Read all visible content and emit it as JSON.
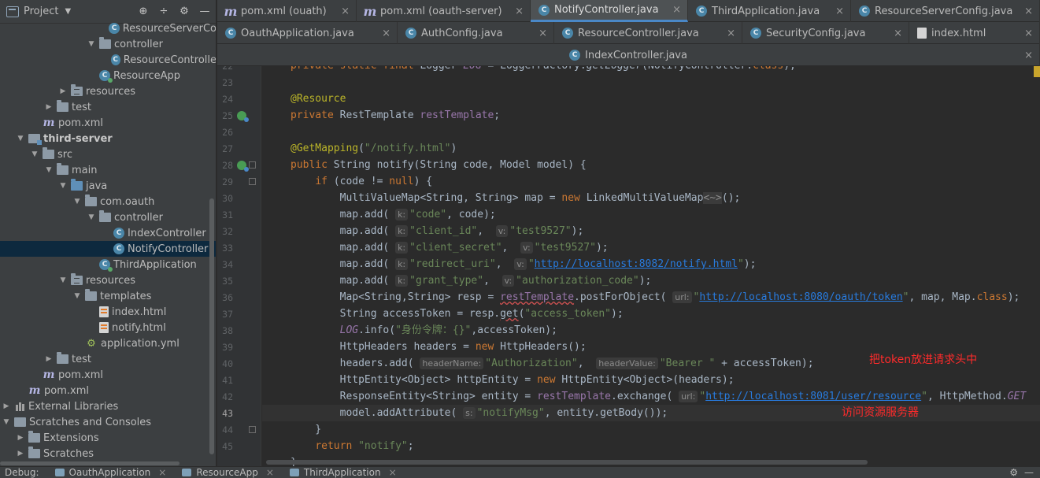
{
  "project_panel": {
    "title": "Project",
    "tree": [
      {
        "label": "ResourceServerCo",
        "icon": "class-icon",
        "indent": 148,
        "arrow": ""
      },
      {
        "label": "controller",
        "icon": "package-folder-icon",
        "indent": 130,
        "arrow": "▼"
      },
      {
        "label": "ResourceControlle",
        "icon": "class-icon",
        "indent": 166,
        "arrow": ""
      },
      {
        "label": "ResourceApp",
        "icon": "spring-app-icon",
        "indent": 130,
        "arrow": ""
      },
      {
        "label": "resources",
        "icon": "resources-folder-icon",
        "indent": 94,
        "arrow": "▶"
      },
      {
        "label": "test",
        "icon": "folder-icon",
        "indent": 76,
        "arrow": "▶"
      },
      {
        "label": "pom.xml",
        "icon": "maven-icon",
        "indent": 58,
        "arrow": ""
      },
      {
        "label": "third-server",
        "icon": "module-folder-icon",
        "indent": 40,
        "arrow": "▼",
        "bold": true
      },
      {
        "label": "src",
        "icon": "folder-icon",
        "indent": 58,
        "arrow": "▼"
      },
      {
        "label": "main",
        "icon": "folder-icon",
        "indent": 76,
        "arrow": "▼"
      },
      {
        "label": "java",
        "icon": "source-folder-icon",
        "indent": 94,
        "arrow": "▼"
      },
      {
        "label": "com.oauth",
        "icon": "package-folder-icon",
        "indent": 112,
        "arrow": "▼"
      },
      {
        "label": "controller",
        "icon": "package-folder-icon",
        "indent": 130,
        "arrow": "▼"
      },
      {
        "label": "IndexController",
        "icon": "class-icon",
        "indent": 148,
        "arrow": ""
      },
      {
        "label": "NotifyController",
        "icon": "class-icon",
        "indent": 148,
        "arrow": "",
        "selected": true
      },
      {
        "label": "ThirdApplication",
        "icon": "spring-app-icon",
        "indent": 130,
        "arrow": ""
      },
      {
        "label": "resources",
        "icon": "resources-folder-icon",
        "indent": 94,
        "arrow": "▼"
      },
      {
        "label": "templates",
        "icon": "folder-icon",
        "indent": 112,
        "arrow": "▼"
      },
      {
        "label": "index.html",
        "icon": "html-file-icon",
        "indent": 130,
        "arrow": ""
      },
      {
        "label": "notify.html",
        "icon": "html-file-icon",
        "indent": 130,
        "arrow": ""
      },
      {
        "label": "application.yml",
        "icon": "yml-file-icon",
        "indent": 112,
        "arrow": ""
      },
      {
        "label": "test",
        "icon": "folder-icon",
        "indent": 76,
        "arrow": "▶"
      },
      {
        "label": "pom.xml",
        "icon": "maven-icon",
        "indent": 58,
        "arrow": ""
      },
      {
        "label": "pom.xml",
        "icon": "maven-icon",
        "indent": 40,
        "arrow": ""
      },
      {
        "label": "External Libraries",
        "icon": "libraries-icon",
        "indent": 22,
        "arrow": "▶"
      },
      {
        "label": "Scratches and Consoles",
        "icon": "scratch-icon",
        "indent": 22,
        "arrow": "▼"
      },
      {
        "label": "Extensions",
        "icon": "folder-icon",
        "indent": 40,
        "arrow": "▶"
      },
      {
        "label": "Scratches",
        "icon": "folder-icon",
        "indent": 40,
        "arrow": "▶"
      }
    ]
  },
  "tabs": {
    "row1": [
      {
        "label": "pom.xml (ouath)",
        "icon": "maven-icon"
      },
      {
        "label": "pom.xml (oauth-server)",
        "icon": "maven-icon"
      },
      {
        "label": "NotifyController.java",
        "icon": "class-icon",
        "active": true
      },
      {
        "label": "ThirdApplication.java",
        "icon": "spring-app-icon"
      },
      {
        "label": "ResourceServerConfig.java",
        "icon": "class-icon"
      }
    ],
    "row2": [
      {
        "label": "OauthApplication.java",
        "icon": "spring-app-icon"
      },
      {
        "label": "AuthConfig.java",
        "icon": "class-icon"
      },
      {
        "label": "ResourceController.java",
        "icon": "class-icon"
      },
      {
        "label": "SecurityConfig.java",
        "icon": "class-icon"
      },
      {
        "label": "index.html",
        "icon": "html-file-icon"
      }
    ],
    "row3": [
      {
        "label": "IndexController.java",
        "icon": "class-icon"
      }
    ],
    "close_glyph": "×"
  },
  "editor": {
    "line_numbers": [
      "22",
      "23",
      "24",
      "25",
      "26",
      "27",
      "28",
      "29",
      "30",
      "31",
      "32",
      "33",
      "34",
      "35",
      "36",
      "37",
      "38",
      "39",
      "40",
      "41",
      "42",
      "43",
      "44",
      "45"
    ],
    "current_line": "43",
    "annotations": {
      "header_note": "把token放进请求头中",
      "resource_note": "访问资源服务器"
    }
  },
  "debug_bar": {
    "label": "Debug:",
    "tabs": [
      "OauthApplication",
      "ResourceApp",
      "ThirdApplication"
    ]
  }
}
